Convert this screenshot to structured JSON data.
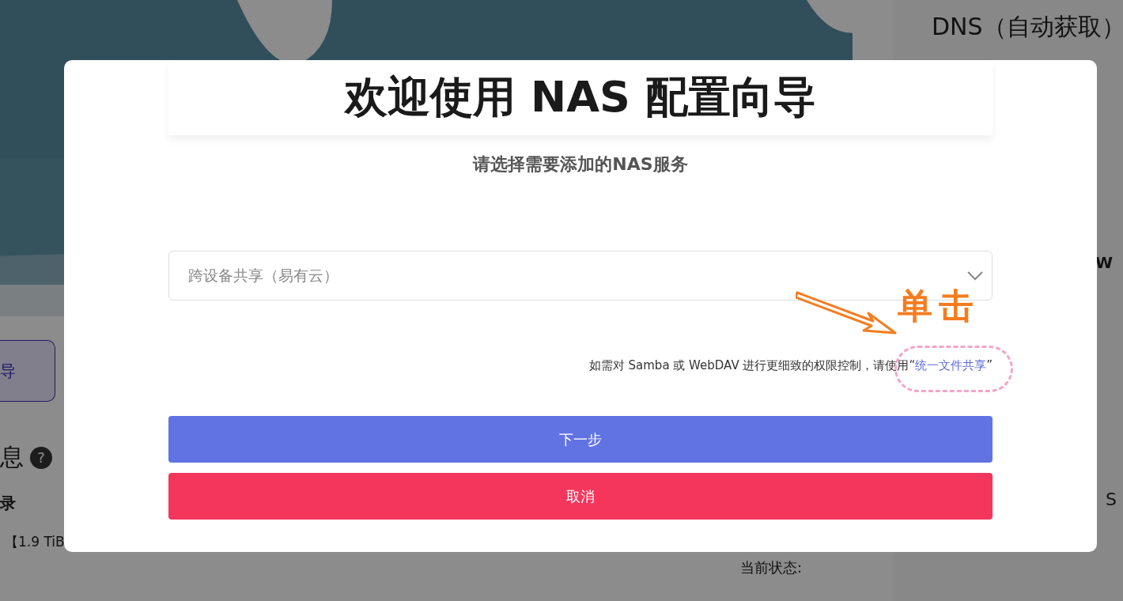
{
  "background": {
    "left": {
      "button_label": "导",
      "section_title": "息",
      "help": "?",
      "subsection": "录",
      "disk": "【1.9 TiB"
    },
    "status_label": "当前状态:",
    "right": {
      "dns": "DNS（自动获取）",
      "row_1": "W",
      "row_2": "S"
    }
  },
  "dialog": {
    "title": "欢迎使用 NAS 配置向导",
    "subtitle": "请选择需要添加的NAS服务",
    "select": {
      "value": "跨设备共享（易有云）"
    },
    "hint": {
      "text": "如需对 Samba 或 WebDAV 进行更细致的权限控制，请使用“",
      "link": "统一文件共享",
      "after": "”"
    },
    "annotation": {
      "text": "单击"
    },
    "buttons": [
      {
        "label": "下一步",
        "kind": "primary"
      },
      {
        "label": "取消",
        "kind": "danger"
      }
    ]
  }
}
